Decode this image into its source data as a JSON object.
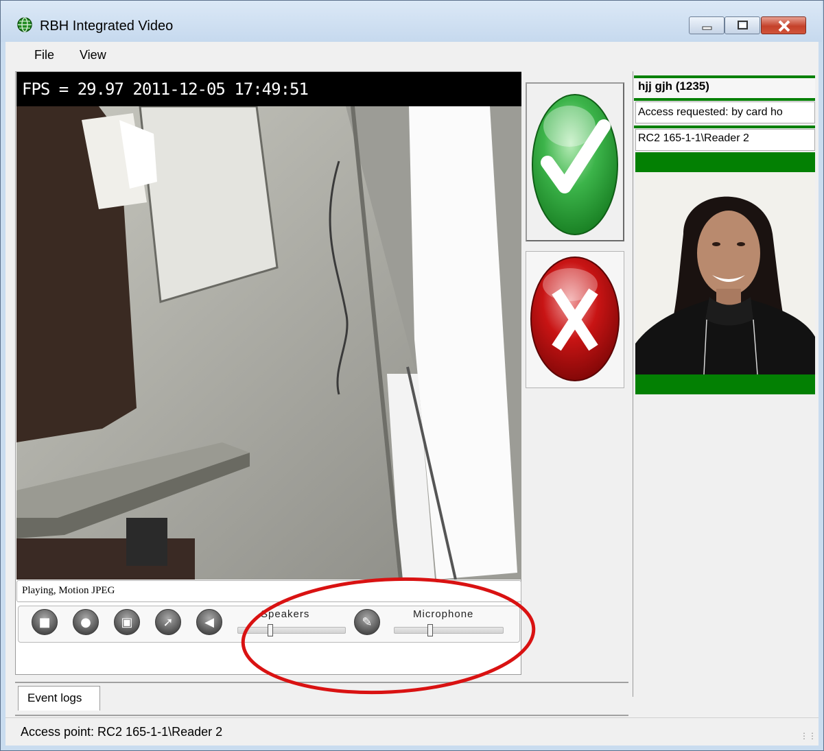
{
  "window": {
    "title": "RBH Integrated Video"
  },
  "menu": {
    "items": [
      "File",
      "View"
    ]
  },
  "video": {
    "overlay_text": "FPS = 29.97 2011-12-05 17:49:51",
    "status": "Playing, Motion JPEG",
    "controls": {
      "speakers_label": "Speakers",
      "microphone_label": "Microphone"
    }
  },
  "access_panel": {
    "cardholder": "hjj gjh (1235)",
    "access_message": "Access requested: by card ho",
    "reader": "RC2 165-1-1\\Reader 2"
  },
  "tabs": [
    "Event logs"
  ],
  "statusbar": {
    "text": "Access point: RC2 165-1-1\\Reader 2"
  },
  "colors": {
    "accept": "#1f9a2c",
    "deny": "#b10a0a",
    "indicator_green": "#038003",
    "annotation": "#d91212"
  }
}
